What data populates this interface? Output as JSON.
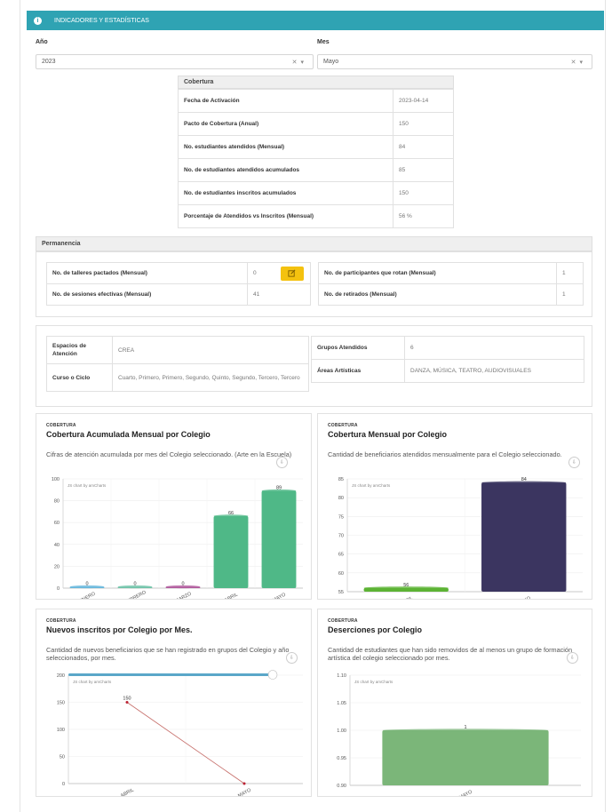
{
  "header": {
    "title": "INDICADORES Y ESTADÍSTICAS"
  },
  "filters": {
    "year_label": "Año",
    "year_value": "2023",
    "month_label": "Mes",
    "month_value": "Mayo",
    "clear_symbol": "✕",
    "arrow_symbol": "▾"
  },
  "coverage": {
    "title": "Cobertura",
    "rows": [
      {
        "label": "Fecha de Activación",
        "value": "2023-04-14"
      },
      {
        "label": "Pacto de Cobertura (Anual)",
        "value": "150"
      },
      {
        "label": "No. estudiantes atendidos (Mensual)",
        "value": "84"
      },
      {
        "label": "No. de estudiantes atendidos acumulados",
        "value": "85"
      },
      {
        "label": "No. de estudiantes inscritos acumulados",
        "value": "150"
      },
      {
        "label": "Porcentaje de Atendidos vs Inscritos (Mensual)",
        "value": "56 %"
      }
    ]
  },
  "permanencia": {
    "title": "Permanencia",
    "left": [
      {
        "label": "No. de talleres pactados (Mensual)",
        "value": "0"
      },
      {
        "label": "No. de sesiones efectivas (Mensual)",
        "value": "41"
      }
    ],
    "right": [
      {
        "label": "No. de participantes que rotan (Mensual)",
        "value": "1"
      },
      {
        "label": "No. de retirados (Mensual)",
        "value": "1"
      }
    ]
  },
  "info": {
    "espacios_label": "Espacios de Atención",
    "espacios_value": "CREA",
    "curso_label": "Curso o Ciclo",
    "curso_value": "Cuarto, Primero, Primero, Segundo, Quinto, Segundo, Tercero, Tercero",
    "grupos_label": "Grupos Atendidos",
    "grupos_value": "6",
    "areas_label": "Áreas Artísticas",
    "areas_value": "DANZA, MÚSICA, TEATRO, AUDIOVISUALES"
  },
  "charts": [
    {
      "category": "COBERTURA",
      "title": "Cobertura Acumulada Mensual por Colegio",
      "description": "Cifras de atención acumulada por mes del Colegio seleccionado. (Arte en la Escuela)",
      "credit": "JS chart by amCharts",
      "download_icon": "⇩"
    },
    {
      "category": "COBERTURA",
      "title": "Cobertura Mensual por Colegio",
      "description": "Cantidad de beneficiarios atendidos mensualmente para el Colegio seleccionado.",
      "credit": "JS chart by amCharts",
      "download_icon": "⇩"
    },
    {
      "category": "COBERTURA",
      "title": "Nuevos inscritos por Colegio por Mes.",
      "description": "Cantidad de nuevos beneficiarios que se han registrado en grupos del Colegio y año seleccionados, por mes.",
      "credit": "JS chart by amCharts",
      "download_icon": "⇩"
    },
    {
      "category": "COBERTURA",
      "title": "Deserciones por Colegio",
      "description": "Cantidad de estudiantes que han sido removidos de al menos un grupo de formación artística del colegio seleccionado por mes.",
      "credit": "JS chart by amCharts",
      "download_icon": "⇩"
    }
  ],
  "chart_data": [
    {
      "type": "bar",
      "title": "Cobertura Acumulada Mensual por Colegio",
      "categories": [
        "ENERO",
        "FEBRERO",
        "MARZO",
        "ABRIL",
        "MAYO"
      ],
      "values": [
        0,
        0,
        0,
        66,
        89
      ],
      "value_labels": [
        "0",
        "0",
        "0",
        "66",
        "89"
      ],
      "colors": [
        "#67b7dc",
        "#6fc3a8",
        "#b05a9c",
        "#4fb887",
        "#4fb887"
      ],
      "ylim": [
        0,
        100
      ],
      "yticks": [
        0,
        20,
        40,
        60,
        80,
        100
      ]
    },
    {
      "type": "bar",
      "title": "Cobertura Mensual por Colegio",
      "categories": [
        "ABRIL",
        "MAYO"
      ],
      "values": [
        56,
        84
      ],
      "value_labels": [
        "56",
        "84"
      ],
      "colors": [
        "#5cb334",
        "#3b3560"
      ],
      "ylim": [
        55,
        85
      ],
      "yticks": [
        55,
        60,
        65,
        70,
        75,
        80,
        85
      ]
    },
    {
      "type": "line",
      "title": "Nuevos inscritos por Colegio por Mes.",
      "categories": [
        "ABRIL",
        "MAYO"
      ],
      "values": [
        150,
        0
      ],
      "value_labels": [
        "150",
        ""
      ],
      "colors": [
        "#c8736f"
      ],
      "ylim": [
        0,
        200
      ],
      "yticks": [
        0,
        50,
        100,
        150,
        200
      ]
    },
    {
      "type": "bar",
      "title": "Deserciones por Colegio",
      "categories": [
        "MAYO"
      ],
      "values": [
        1
      ],
      "value_labels": [
        "1"
      ],
      "colors": [
        "#7bb679"
      ],
      "ylim": [
        0.9,
        1.1
      ],
      "yticks": [
        "0.90",
        "0.95",
        "1.00",
        "1.05",
        "1.10"
      ]
    }
  ]
}
